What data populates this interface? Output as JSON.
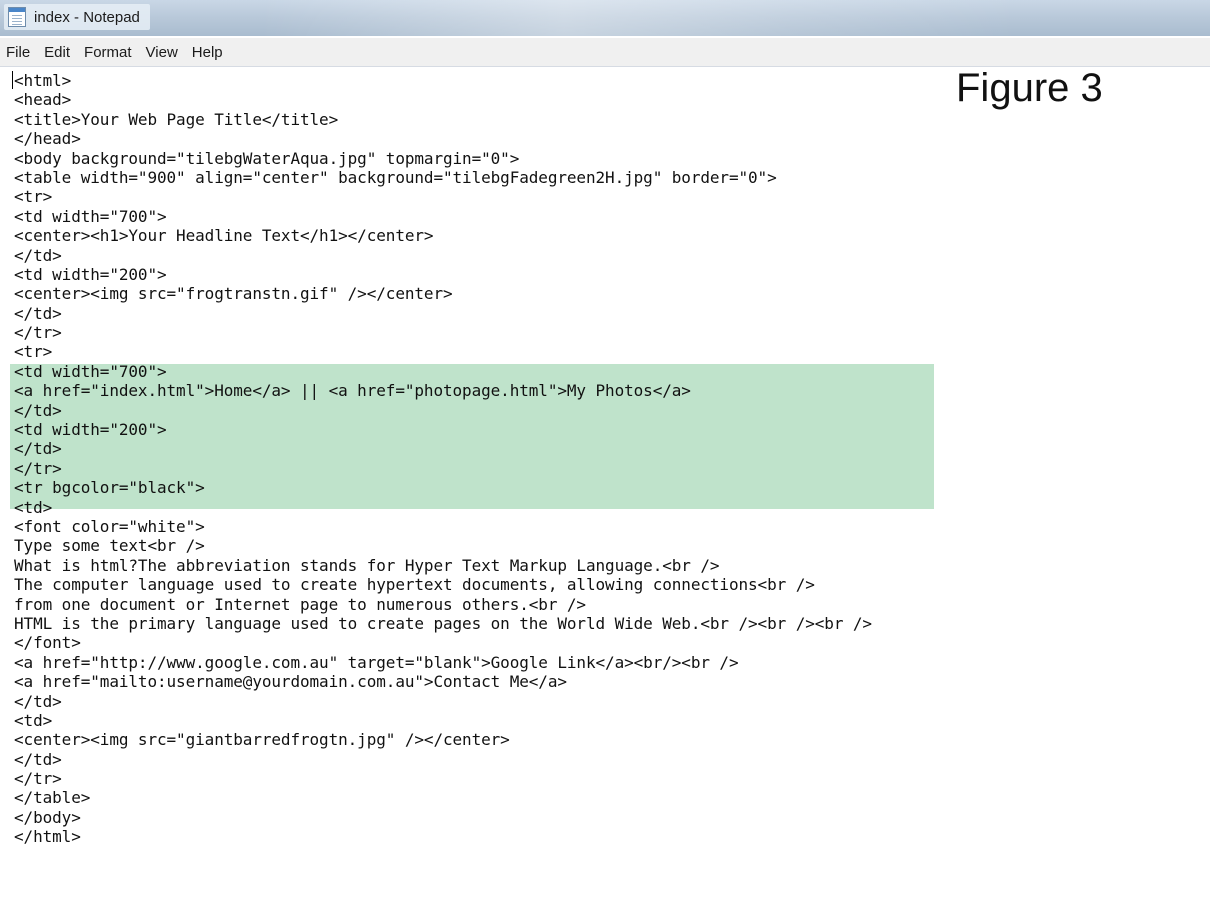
{
  "window": {
    "title": "index - Notepad",
    "icon": "notepad-icon"
  },
  "menu": [
    "File",
    "Edit",
    "Format",
    "View",
    "Help"
  ],
  "figure_label": "Figure 3",
  "highlight_color": "#bfe3cb",
  "code_lines": [
    "<html>",
    "<head>",
    "<title>Your Web Page Title</title>",
    "</head>",
    "<body background=\"tilebgWaterAqua.jpg\" topmargin=\"0\">",
    "<table width=\"900\" align=\"center\" background=\"tilebgFadegreen2H.jpg\" border=\"0\">",
    "<tr>",
    "<td width=\"700\">",
    "<center><h1>Your Headline Text</h1></center>",
    "</td>",
    "<td width=\"200\">",
    "<center><img src=\"frogtranstn.gif\" /></center>",
    "</td>",
    "</tr>",
    "<tr>",
    "<td width=\"700\">",
    "<a href=\"index.html\">Home</a> || <a href=\"photopage.html\">My Photos</a>",
    "</td>",
    "<td width=\"200\">",
    "</td>",
    "</tr>",
    "<tr bgcolor=\"black\">",
    "<td>",
    "<font color=\"white\">",
    "Type some text<br />",
    "What is html?The abbreviation stands for Hyper Text Markup Language.<br />",
    "The computer language used to create hypertext documents, allowing connections<br />",
    "from one document or Internet page to numerous others.<br />",
    "HTML is the primary language used to create pages on the World Wide Web.<br /><br /><br />",
    "</font>",
    "<a href=\"http://www.google.com.au\" target=\"blank\">Google Link</a><br/><br />",
    "<a href=\"mailto:username@yourdomain.com.au\">Contact Me</a>",
    "</td>",
    "<td>",
    "<center><img src=\"giantbarredfrogtn.jpg\" /></center>",
    "</td>",
    "</tr>",
    "</table>",
    "</body>",
    "</html>"
  ]
}
